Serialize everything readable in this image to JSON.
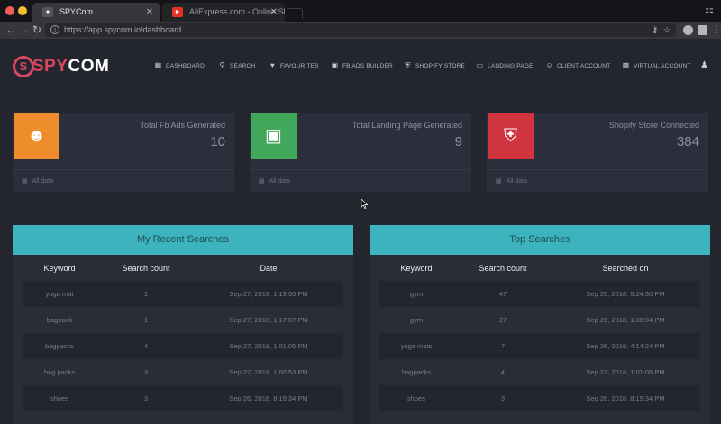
{
  "browser": {
    "tabs": [
      {
        "title": "SPYCom",
        "active": true
      },
      {
        "title": "AliExpress.com - Online Shopp",
        "active": false
      }
    ],
    "url": "https://app.spycom.io/dashboard",
    "colors": {
      "close": "#ee5f57",
      "minimize": "#f5bd30",
      "maximize": "#4dc940",
      "ali": "#e43225"
    }
  },
  "brand": {
    "mark": "S",
    "pink": "SPY",
    "white": "COM",
    "color": "#d9465f"
  },
  "nav": {
    "items": [
      {
        "label": "Dashboard",
        "icon": "grid-icon"
      },
      {
        "label": "Search",
        "icon": "search-icon"
      },
      {
        "label": "Favourites",
        "icon": "heart-icon"
      },
      {
        "label": "FB Ads Builder",
        "icon": "ads-icon"
      },
      {
        "label": "Shopify Store",
        "icon": "cart-icon"
      },
      {
        "label": "Landing Page",
        "icon": "page-icon"
      },
      {
        "label": "Client Account",
        "icon": "client-icon"
      },
      {
        "label": "Virtual Account",
        "icon": "id-card-icon"
      }
    ]
  },
  "stats": [
    {
      "title": "Total Fb Ads Generated",
      "count": "10",
      "footer": "All data",
      "color": "#ed8d2c",
      "icon": "smile-icon"
    },
    {
      "title": "Total Landing Page Generated",
      "count": "9",
      "footer": "All data",
      "color": "#41a75a",
      "icon": "expand-icon"
    },
    {
      "title": "Shopify Store Connected",
      "count": "384",
      "footer": "All data",
      "color": "#d0343f",
      "icon": "cart-icon"
    }
  ],
  "recent": {
    "title": "My Recent Searches",
    "headers": [
      "Keyword",
      "Search count",
      "Date"
    ],
    "rows": [
      [
        "yoga mat",
        "1",
        "Sep 27, 2018, 1:19:50 PM"
      ],
      [
        "bagpack",
        "1",
        "Sep 27, 2018, 1:17:07 PM"
      ],
      [
        "bagpacks",
        "4",
        "Sep 27, 2018, 1:01:05 PM"
      ],
      [
        "bag packs",
        "3",
        "Sep 27, 2018, 1:00:53 PM"
      ],
      [
        "shoes",
        "3",
        "Sep 26, 2018, 8:19:34 PM"
      ]
    ]
  },
  "top": {
    "title": "Top Searches",
    "headers": [
      "Keyword",
      "Search count",
      "Searched on"
    ],
    "rows": [
      [
        "gym",
        "47",
        "Sep 26, 2018, 5:24:30 PM"
      ],
      [
        "gym",
        "27",
        "Sep 26, 2018, 1:30:04 PM"
      ],
      [
        "yoga mats",
        "7",
        "Sep 26, 2018, 4:14:24 PM"
      ],
      [
        "bagpacks",
        "4",
        "Sep 27, 2018, 1:01:05 PM"
      ],
      [
        "shoes",
        "3",
        "Sep 26, 2018, 8:19:34 PM"
      ]
    ]
  },
  "theme": {
    "accent": "#3cb3bd",
    "card_bg": "#2c2e3b",
    "page_bg": "#23252f"
  }
}
